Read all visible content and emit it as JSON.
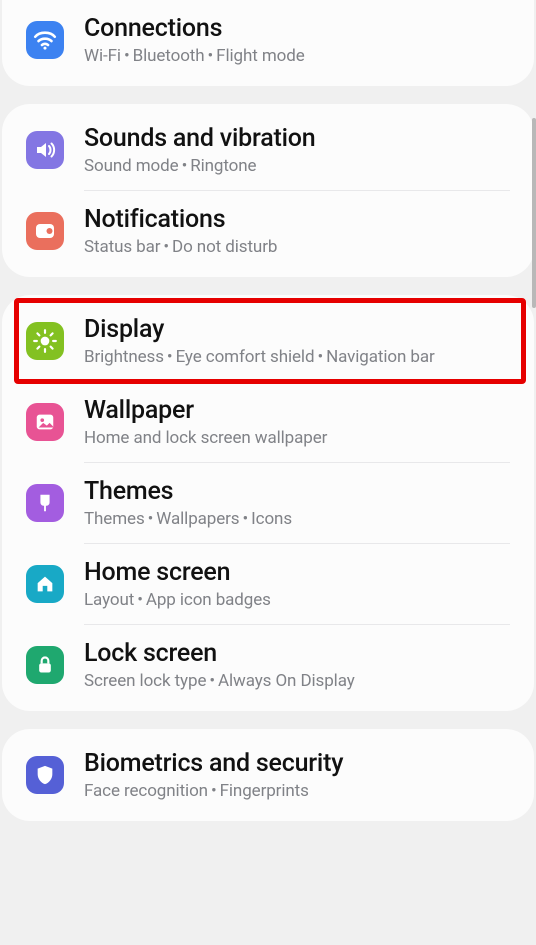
{
  "groups": [
    {
      "items": [
        {
          "key": "connections",
          "title": "Connections",
          "subtitle_parts": [
            "Wi-Fi",
            "Bluetooth",
            "Flight mode"
          ],
          "icon": "wifi",
          "color": "#3c82f1"
        }
      ]
    },
    {
      "items": [
        {
          "key": "sounds",
          "title": "Sounds and vibration",
          "subtitle_parts": [
            "Sound mode",
            "Ringtone"
          ],
          "icon": "sound",
          "color": "#8376e3"
        },
        {
          "key": "notifications",
          "title": "Notifications",
          "subtitle_parts": [
            "Status bar",
            "Do not disturb"
          ],
          "icon": "notif",
          "color": "#ea6f5d"
        }
      ]
    },
    {
      "items": [
        {
          "key": "display",
          "title": "Display",
          "subtitle_parts": [
            "Brightness",
            "Eye comfort shield",
            "Navigation bar"
          ],
          "icon": "brightness",
          "color": "#83c121",
          "highlight": true
        },
        {
          "key": "wallpaper",
          "title": "Wallpaper",
          "subtitle_parts": [
            "Home and lock screen wallpaper"
          ],
          "icon": "picture",
          "color": "#e85394"
        },
        {
          "key": "themes",
          "title": "Themes",
          "subtitle_parts": [
            "Themes",
            "Wallpapers",
            "Icons"
          ],
          "icon": "brush",
          "color": "#a35de0"
        },
        {
          "key": "homescreen",
          "title": "Home screen",
          "subtitle_parts": [
            "Layout",
            "App icon badges"
          ],
          "icon": "home",
          "color": "#18a9c6"
        },
        {
          "key": "lockscreen",
          "title": "Lock screen",
          "subtitle_parts": [
            "Screen lock type",
            "Always On Display"
          ],
          "icon": "lock",
          "color": "#1fa86f"
        }
      ]
    },
    {
      "items": [
        {
          "key": "biometrics",
          "title": "Biometrics and security",
          "subtitle_parts": [
            "Face recognition",
            "Fingerprints"
          ],
          "icon": "shield",
          "color": "#5560d6"
        }
      ]
    }
  ],
  "subtitle_separator": "  •  "
}
